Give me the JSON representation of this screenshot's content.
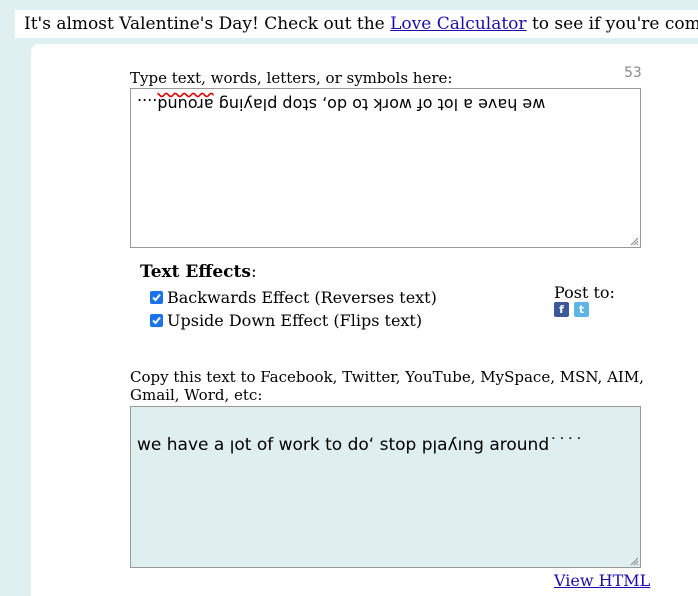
{
  "banner": {
    "text_before": "It's almost Valentine's Day! Check out the ",
    "link_label": "Love Calculator",
    "text_after": " to see if you're compatible"
  },
  "input": {
    "label": "Type text, words, letters, or symbols here:",
    "char_count": "53",
    "value_start": "we have a lot of work to do, stop playing ",
    "value_misspelled": "around",
    "value_end": "...."
  },
  "effects": {
    "title": "Text Effects",
    "title_suffix": ":",
    "options": [
      {
        "label": "Backwards Effect (Reverses text)",
        "checked": true
      },
      {
        "label": "Upside Down Effect (Flips text)",
        "checked": true
      }
    ]
  },
  "share": {
    "label": "Post to:",
    "icons": [
      "facebook-icon",
      "twitter-icon"
    ]
  },
  "output": {
    "label": "Copy this text to Facebook, Twitter, YouTube, MySpace, MSN, AIM, Gmail, Word, etc:",
    "value": "we have a ןot of work to do‘ stop pןaʎıng around˙˙˙˙"
  },
  "view_html_label": "View HTML",
  "colors": {
    "background": "#dff0f0",
    "output_bg": "#dfeff0",
    "link": "#1a0dab",
    "checkbox": "#1a73e8",
    "facebook": "#3b5998",
    "twitter": "#5fb5e6"
  }
}
